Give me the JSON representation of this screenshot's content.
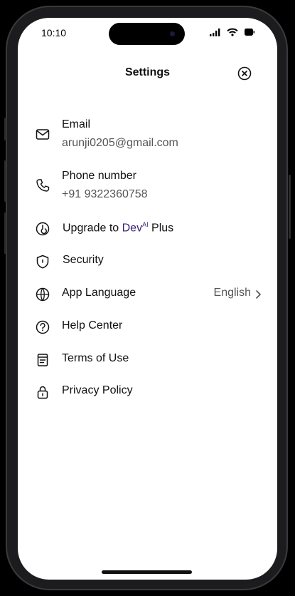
{
  "status_bar": {
    "time": "10:10"
  },
  "header": {
    "title": "Settings"
  },
  "items": {
    "email": {
      "label": "Email",
      "value": "arunji0205@gmail.com"
    },
    "phone": {
      "label": "Phone number",
      "value": "+91 9322360758"
    },
    "upgrade": {
      "prefix": "Upgrade to ",
      "brand": "Dev",
      "brand_sup": "AI",
      "suffix": " Plus"
    },
    "security": {
      "label": "Security"
    },
    "language": {
      "label": "App Language",
      "value": "English"
    },
    "help": {
      "label": "Help Center"
    },
    "terms": {
      "label": "Terms of Use"
    },
    "privacy": {
      "label": "Privacy Policy"
    }
  },
  "colors": {
    "brand": "#3a1f7a",
    "text": "#111111",
    "secondary": "#555555"
  }
}
